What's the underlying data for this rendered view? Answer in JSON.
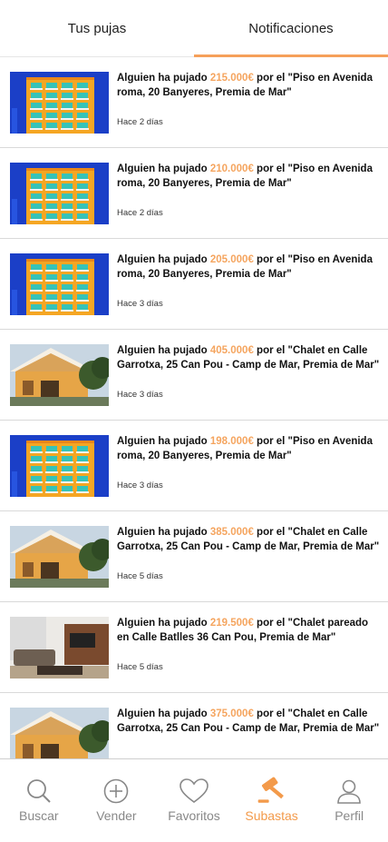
{
  "tabs": [
    {
      "label": "Tus pujas"
    },
    {
      "label": "Notificaciones"
    }
  ],
  "notifications": [
    {
      "prefix": "Alguien ha pujado ",
      "price": "215.000€",
      "suffix": " por el \"Piso en Avenida roma, 20 Banyeres, Premia de Mar\"",
      "time": "Hace 2 días",
      "image": "apartment-building"
    },
    {
      "prefix": "Alguien ha pujado ",
      "price": "210.000€",
      "suffix": " por el \"Piso en Avenida roma, 20 Banyeres, Premia de Mar\"",
      "time": "Hace 2 días",
      "image": "apartment-building"
    },
    {
      "prefix": "Alguien ha pujado ",
      "price": "205.000€",
      "suffix": " por el \"Piso en Avenida roma, 20 Banyeres, Premia de Mar\"",
      "time": "Hace 3 días",
      "image": "apartment-building"
    },
    {
      "prefix": "Alguien ha pujado ",
      "price": "405.000€",
      "suffix": " por el \"Chalet en Calle Garrotxa, 25 Can Pou - Camp de Mar, Premia de Mar\"",
      "time": "Hace 3 días",
      "image": "chalet-house"
    },
    {
      "prefix": "Alguien ha pujado ",
      "price": "198.000€",
      "suffix": " por el \"Piso en Avenida roma, 20 Banyeres, Premia de Mar\"",
      "time": "Hace 3 días",
      "image": "apartment-building"
    },
    {
      "prefix": "Alguien ha pujado ",
      "price": "385.000€",
      "suffix": " por el \"Chalet en Calle Garrotxa, 25 Can Pou - Camp de Mar, Premia de Mar\"",
      "time": "Hace 5 días",
      "image": "chalet-house"
    },
    {
      "prefix": "Alguien ha pujado ",
      "price": "219.500€",
      "suffix": " por el \"Chalet pareado en Calle Batlles 36 Can Pou, Premia de Mar\"",
      "time": "Hace 5 días",
      "image": "living-room"
    },
    {
      "prefix": "Alguien ha pujado ",
      "price": "375.000€",
      "suffix": " por el \"Chalet en Calle Garrotxa, 25 Can Pou - Camp de Mar, Premia de Mar\"",
      "time": "",
      "image": "chalet-house"
    }
  ],
  "bottom_nav": [
    {
      "label": "Buscar",
      "icon": "search-icon"
    },
    {
      "label": "Vender",
      "icon": "plus-circle-icon"
    },
    {
      "label": "Favoritos",
      "icon": "heart-icon"
    },
    {
      "label": "Subastas",
      "icon": "gavel-icon"
    },
    {
      "label": "Perfil",
      "icon": "user-icon"
    }
  ],
  "colors": {
    "accent": "#f39a4a",
    "price": "#f5a55f",
    "muted": "#888888"
  }
}
